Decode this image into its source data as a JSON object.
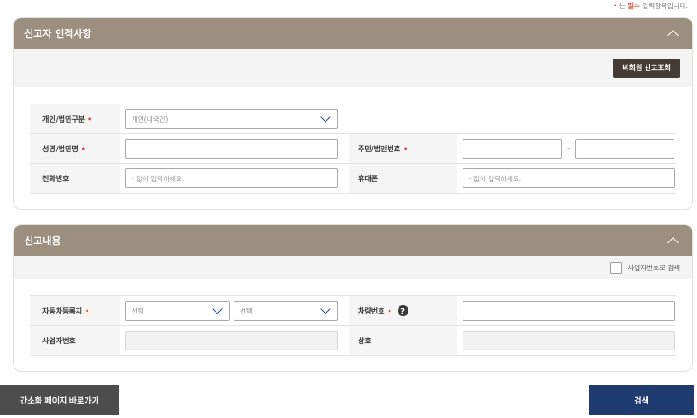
{
  "required_note": {
    "dot": "•",
    "prefix": " 는 ",
    "em": "필수",
    "suffix": " 입력항목입니다."
  },
  "reporter": {
    "title": "신고자 인적사항",
    "guest_lookup_button": "비회원 신고조회",
    "fields": {
      "type_label": "개인/법인구분",
      "type_value": "개인(내국인)",
      "name_label": "성명/법인명",
      "id_label": "주민/법인번호",
      "id_separator": "-",
      "phone_label": "전화번호",
      "phone_placeholder": "- 없이 입력하세요.",
      "mobile_label": "휴대폰",
      "mobile_placeholder": "- 없이 입력하세요."
    }
  },
  "report": {
    "title": "신고내용",
    "biz_search_checkbox": "사업자번호로 검색",
    "fields": {
      "region_label": "자동차등록지",
      "region_select1": "선택",
      "region_select2": "선택",
      "plate_label": "차량번호",
      "biz_no_label": "사업자번호",
      "company_label": "상호"
    }
  },
  "required_mark": "•",
  "help_icon": "?",
  "buttons": {
    "simple_page": "간소화 페이지 바로가기",
    "search": "검색"
  }
}
